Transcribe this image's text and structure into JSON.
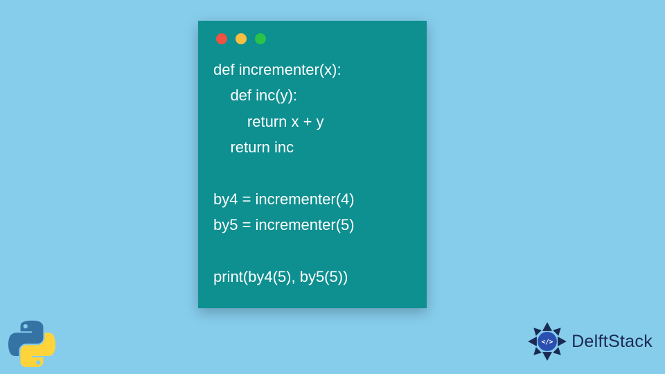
{
  "code_window": {
    "lines": [
      "def incrementer(x):",
      "    def inc(y):",
      "        return x + y",
      "    return inc",
      "",
      "by4 = incrementer(4)",
      "by5 = incrementer(5)",
      "",
      "print(by4(5), by5(5))"
    ]
  },
  "brand": {
    "name": "DelftStack"
  },
  "colors": {
    "background": "#86cdec",
    "window": "#0e8f90",
    "text": "#ffffff",
    "brand_text": "#1a2a52"
  }
}
